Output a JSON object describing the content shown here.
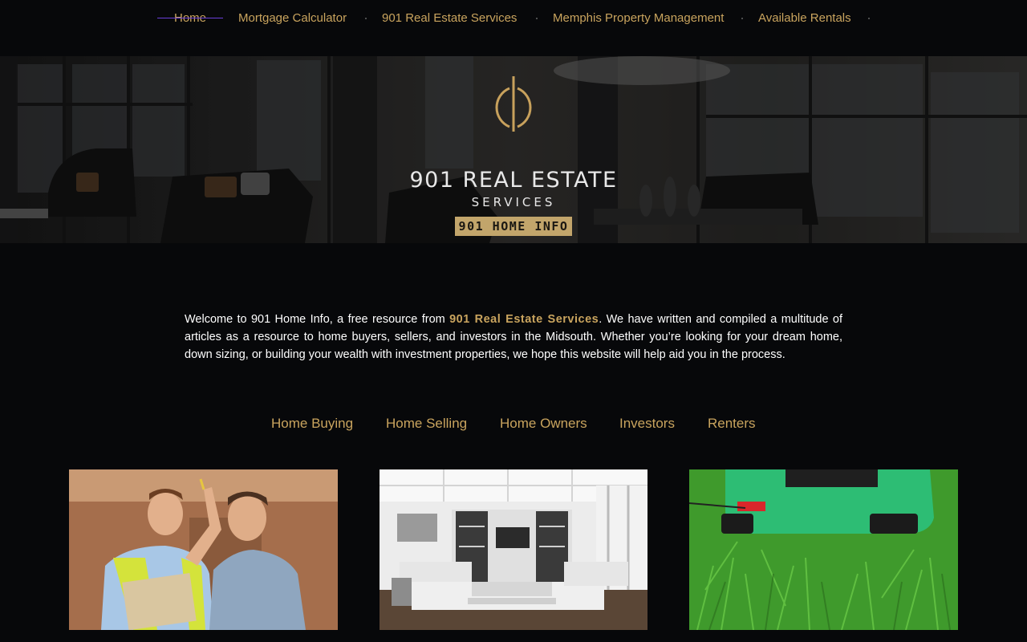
{
  "nav": {
    "items": [
      {
        "label": "Home",
        "active": true
      },
      {
        "label": "Mortgage Calculator"
      },
      {
        "label": "901 Real Estate Services"
      },
      {
        "label": "Memphis Property Management"
      },
      {
        "label": "Available Rentals"
      }
    ]
  },
  "hero": {
    "logo": {
      "name": "901 REAL ESTATE",
      "subtitle": "SERVICES",
      "badge": "901 HOME INFO",
      "icon": "gold-circle-logo-icon"
    }
  },
  "intro": {
    "before": "Welcome to 901 Home Info, a free resource from ",
    "link": "901 Real Estate Services",
    "after": ". We have written and compiled a multitude of articles as a resource to home buyers, sellers, and investors in the Midsouth. Whether you’re looking for your dream home, down sizing, or building your wealth with investment properties, we hope this website will help aid you in the process."
  },
  "categories": [
    {
      "label": "Home Buying"
    },
    {
      "label": "Home Selling"
    },
    {
      "label": "Home Owners"
    },
    {
      "label": "Investors"
    },
    {
      "label": "Renters"
    }
  ],
  "cards": [
    {
      "image": "home-inspection-photo"
    },
    {
      "image": "living-room-photo"
    },
    {
      "image": "lawn-mower-photo"
    }
  ],
  "colors": {
    "background": "#07080a",
    "accent_gold": "#c9a45e",
    "active_underline": "#6a3fd8",
    "text": "#ffffff"
  }
}
